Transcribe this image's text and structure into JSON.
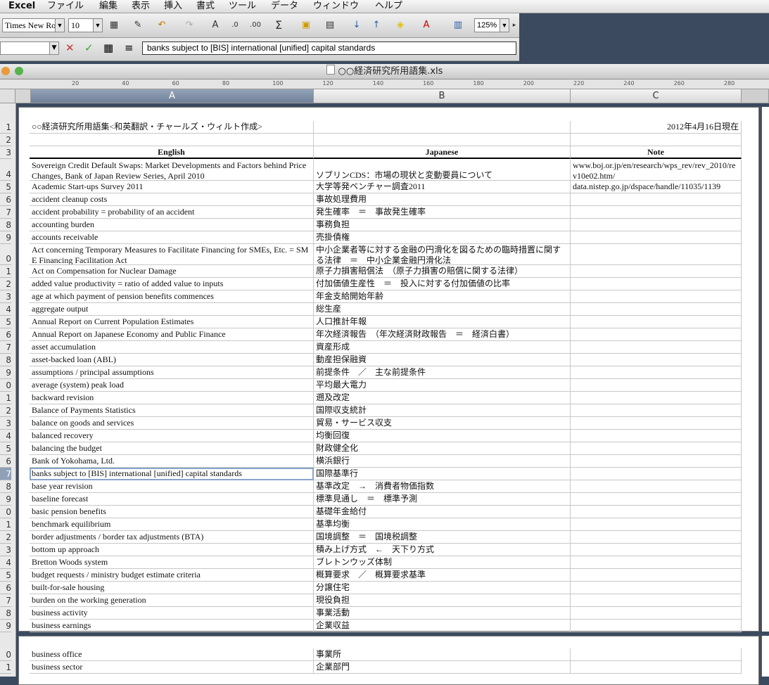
{
  "menu": {
    "app": "Excel",
    "items": [
      "ファイル",
      "編集",
      "表示",
      "挿入",
      "書式",
      "ツール",
      "データ",
      "ウィンドウ",
      "ヘルプ"
    ]
  },
  "toolbar": {
    "font_name": "Times New Ro",
    "font_size": "10",
    "zoom": "125%"
  },
  "formula_bar": {
    "name_box": "",
    "content": "banks subject to [BIS] international [unified] capital standards"
  },
  "window": {
    "title": "○○経済研究所用語集.xls"
  },
  "ruler": {
    "ticks": [
      "20",
      "40",
      "60",
      "80",
      "100",
      "120",
      "140",
      "160",
      "180",
      "200",
      "220",
      "240",
      "260",
      "280"
    ]
  },
  "columns": [
    "A",
    "B",
    "C"
  ],
  "row_numbers": [
    "1",
    "2",
    "3",
    "4",
    "5",
    "6",
    "7",
    "8",
    "9",
    "0",
    "1",
    "2",
    "3",
    "4",
    "5",
    "6",
    "7",
    "8",
    "9",
    "0",
    "1",
    "2",
    "3",
    "4",
    "5",
    "6",
    "7",
    "8",
    "9",
    "0",
    "1",
    "2",
    "3",
    "4",
    "5",
    "6",
    "7",
    "8",
    "9",
    "0",
    "1"
  ],
  "sheet": {
    "title": "○○経済研究所用語集<和英翻訳・チャールズ・ウィルト作成>",
    "date": "2012年4月16日現在",
    "headers": {
      "english": "English",
      "japanese": "Japanese",
      "note": "Note"
    },
    "rows": [
      {
        "en": "Sovereign Credit Default Swaps: Market Developments and Factors behind Price Changes, Bank of Japan Review Series, April 2010",
        "ja": "ソブリンCDS：市場の現状と変動要員について",
        "note": "www.boj.or.jp/en/research/wps_rev/rev_2010/rev10e02.htm/"
      },
      {
        "en": "Academic Start-ups Survey 2011",
        "ja": "大学等発ベンチャー調査2011",
        "note": "data.nistep.go.jp/dspace/handle/11035/1139"
      },
      {
        "en": "accident cleanup costs",
        "ja": "事故処理費用",
        "note": ""
      },
      {
        "en": "accident probability = probability of an accident",
        "ja": "発生確率　＝　事故発生確率",
        "note": ""
      },
      {
        "en": "accounting burden",
        "ja": "事務負担",
        "note": ""
      },
      {
        "en": "accounts receivable",
        "ja": "売掛債権",
        "note": ""
      },
      {
        "en": "Act concerning Temporary Measures to Facilitate Financing for SMEs, Etc. = SME Financing Facilitation Act",
        "ja": "中小企業者等に対する金融の円滑化を図るための臨時措置に関する法律　＝　中小企業金融円滑化法",
        "note": ""
      },
      {
        "en": "Act on Compensation for Nuclear Damage",
        "ja": "原子力損害賠償法　（原子力損害の賠償に関する法律）",
        "note": ""
      },
      {
        "en": "added value productivity = ratio of added value to inputs",
        "ja": "付加価値生産性　＝　投入に対する付加価値の比率",
        "note": ""
      },
      {
        "en": "age at which payment of pension benefits commences",
        "ja": "年金支給開始年齢",
        "note": ""
      },
      {
        "en": "aggregate output",
        "ja": "総生産",
        "note": ""
      },
      {
        "en": "Annual Report on Current Population Estimates",
        "ja": "人口推計年報",
        "note": ""
      },
      {
        "en": "Annual Report on Japanese Economy and Public Finance",
        "ja": "年次経済報告　（年次経済財政報告　＝　経済白書）",
        "note": ""
      },
      {
        "en": "asset accumulation",
        "ja": "資産形成",
        "note": ""
      },
      {
        "en": "asset-backed loan (ABL)",
        "ja": "動産担保融資",
        "note": ""
      },
      {
        "en": "assumptions / principal assumptions",
        "ja": "前提条件　／　主な前提条件",
        "note": ""
      },
      {
        "en": "average (system) peak load",
        "ja": "平均最大電力",
        "note": ""
      },
      {
        "en": "backward revision",
        "ja": "遡及改定",
        "note": ""
      },
      {
        "en": "Balance of Payments Statistics",
        "ja": "国際収支統計",
        "note": ""
      },
      {
        "en": "balance on goods and services",
        "ja": "貿易・サービス収支",
        "note": ""
      },
      {
        "en": "balanced recovery",
        "ja": "均衡回復",
        "note": ""
      },
      {
        "en": "balancing the budget",
        "ja": "財政健全化",
        "note": ""
      },
      {
        "en": "Bank of Yokohama, Ltd.",
        "ja": "横浜銀行",
        "note": ""
      },
      {
        "en": "banks subject to [BIS] international [unified] capital standards",
        "ja": "国際基準行",
        "note": ""
      },
      {
        "en": "base year revision",
        "ja": "基準改定　→　消費者物価指数",
        "note": ""
      },
      {
        "en": "baseline forecast",
        "ja": "標準見通し　＝　標準予測",
        "note": ""
      },
      {
        "en": "basic pension benefits",
        "ja": "基礎年金給付",
        "note": ""
      },
      {
        "en": "benchmark equilibrium",
        "ja": "基準均衡",
        "note": ""
      },
      {
        "en": "border adjustments / border tax adjustments (BTA)",
        "ja": "国境調整　＝　国境税調整",
        "note": ""
      },
      {
        "en": "bottom up approach",
        "ja": "積み上げ方式　←　天下り方式",
        "note": ""
      },
      {
        "en": "Bretton Woods system",
        "ja": "ブレトンウッズ体制",
        "note": ""
      },
      {
        "en": "budget requests / ministry budget estimate criteria",
        "ja": "概算要求　／　概算要求基準",
        "note": ""
      },
      {
        "en": "built-for-sale housing",
        "ja": "分譲住宅",
        "note": ""
      },
      {
        "en": "burden on the working generation",
        "ja": "現役負担",
        "note": ""
      },
      {
        "en": "business activity",
        "ja": "事業活動",
        "note": ""
      },
      {
        "en": "business earnings",
        "ja": "企業収益",
        "note": ""
      }
    ],
    "rows_page2": [
      {
        "en": "business office",
        "ja": "事業所",
        "note": ""
      },
      {
        "en": "business sector",
        "ja": "企業部門",
        "note": ""
      }
    ],
    "active_row_index": 23
  }
}
